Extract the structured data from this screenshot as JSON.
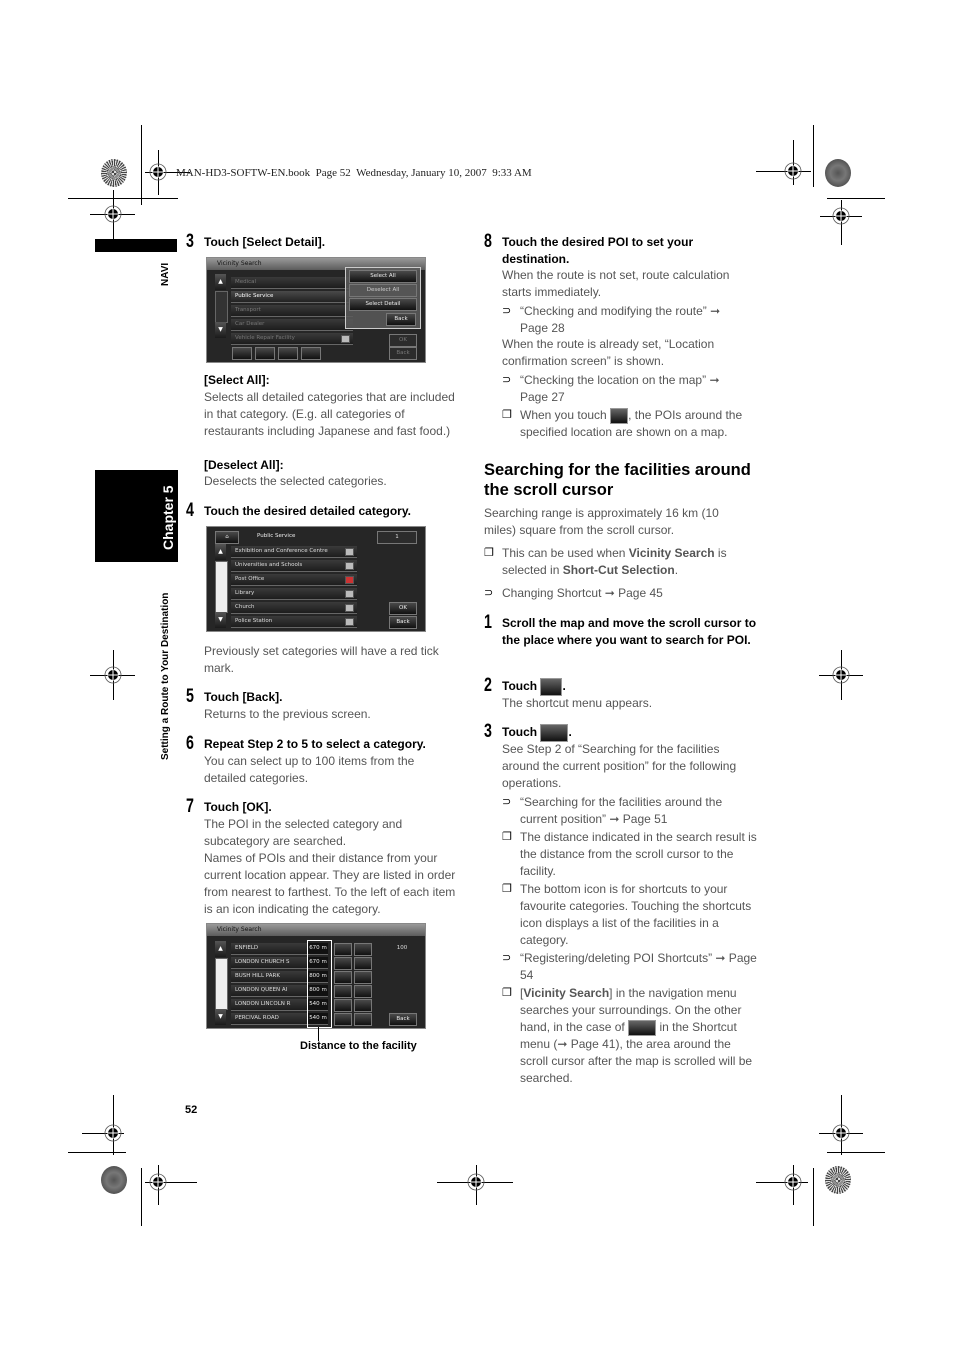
{
  "header": {
    "text": "MAN-HD3-SOFTW-EN.book  Page 52  Wednesday, January 10, 2007  9:33 AM"
  },
  "side": {
    "navi": "NAVI",
    "chapter": "Chapter 5",
    "section": "Setting a Route to Your Destination"
  },
  "page_number": "52",
  "left": {
    "step3": {
      "num": "3",
      "heading": "Touch [Select Detail]."
    },
    "screen1": {
      "title": "Vicinity Search",
      "rows": [
        "Medical",
        "Public Service",
        "Transport",
        "Car Dealer",
        "Vehicle Repair Facility"
      ],
      "popup": [
        "Select All",
        "Deselect All",
        "Select Detail",
        "Back"
      ],
      "ok": "OK",
      "back": "Back"
    },
    "select_all": {
      "term": "[Select All]:",
      "desc": "Selects all detailed categories that are included in that category. (E.g. all categories of restaurants including Japanese and fast food.)"
    },
    "deselect_all": {
      "term": "[Deselect All]:",
      "desc": "Deselects the selected categories."
    },
    "step4": {
      "num": "4",
      "heading": "Touch the desired detailed category."
    },
    "screen2": {
      "title": "Public Service",
      "count": "1",
      "rows": [
        "Exhibition and Conference Centre",
        "Universities and Schools",
        "Post Office",
        "Library",
        "Church",
        "Police Station"
      ],
      "checked_index": 2,
      "ok": "OK",
      "back": "Back"
    },
    "step4_note": "Previously set categories will have a red tick mark.",
    "step5": {
      "num": "5",
      "heading": "Touch [Back].",
      "body": "Returns to the previous screen."
    },
    "step6": {
      "num": "6",
      "heading": "Repeat Step 2 to 5 to select a category.",
      "body": "You can select up to 100 items from the detailed categories."
    },
    "step7": {
      "num": "7",
      "heading": "Touch [OK].",
      "body1": "The POI in the selected category and subcategory are searched.",
      "body2": "Names of POIs and their distance from your current location appear. They are listed in order from nearest to farthest. To the left of each item is an icon indicating the category."
    },
    "screen3": {
      "title": "Vicinity Search",
      "count": "100",
      "rows": [
        {
          "name": "ENFIELD",
          "dist": "670",
          "unit": "m"
        },
        {
          "name": "LONDON CHURCH S",
          "dist": "670",
          "unit": "m"
        },
        {
          "name": "BUSH HILL PARK",
          "dist": "800",
          "unit": "m"
        },
        {
          "name": "LONDON QUEEN AI",
          "dist": "800",
          "unit": "m"
        },
        {
          "name": "LONDON LINCOLN R",
          "dist": "540",
          "unit": "m"
        },
        {
          "name": "PERCIVAL ROAD",
          "dist": "540",
          "unit": "m"
        }
      ],
      "back": "Back",
      "callout": "Distance to the facility"
    }
  },
  "right": {
    "step8": {
      "num": "8",
      "heading": "Touch the desired POI to set your destination.",
      "body1": "When the route is not set, route calculation starts immediately.",
      "ref1": "“Checking and modifying the route” ➞ Page 28",
      "body2": "When the route is already set, “Location confirmation screen” is shown.",
      "ref2": "“Checking the location on the map” ➞ Page 27",
      "note_pre": "When you touch",
      "note_post": ", the POIs around the specified location are shown on a map."
    },
    "section": {
      "title": "Searching for the facilities around the scroll cursor",
      "intro": "Searching range is approximately 16 km (10 miles) square from the scroll cursor.",
      "note_pre": "This can be used when ",
      "note_b1": "Vicinity Search",
      "note_mid": " is selected in ",
      "note_b2": "Short-Cut Selection",
      "note_end": ".",
      "ref": "Changing Shortcut ➞ Page 45"
    },
    "step1": {
      "num": "1",
      "heading": "Scroll the map and move the scroll cursor to the place where you want to search for POI."
    },
    "step2": {
      "num": "2",
      "heading_pre": "Touch",
      "heading_post": ".",
      "body": "The shortcut menu appears."
    },
    "step3": {
      "num": "3",
      "heading_pre": "Touch",
      "heading_post": ".",
      "body": "See Step 2 of “Searching for the facilities around the current position” for the following operations.",
      "ref1": "“Searching for the facilities around the current position” ➞ Page 51",
      "note1": "The distance indicated in the search result is the distance from the scroll cursor to the facility.",
      "note2": "The bottom icon is for shortcuts to your favourite categories. Touching the shortcuts icon displays a list of the facilities in a category.",
      "ref2": "“Registering/deleting POI Shortcuts” ➞ Page 54",
      "note3_b": "Vicinity Search",
      "note3_a": "] in the navigation menu searches your surroundings. On the other hand, in the case of",
      "note3_c": "in the Shortcut menu (➞ Page 41), the area around the scroll cursor after the map is scrolled will be searched."
    }
  }
}
